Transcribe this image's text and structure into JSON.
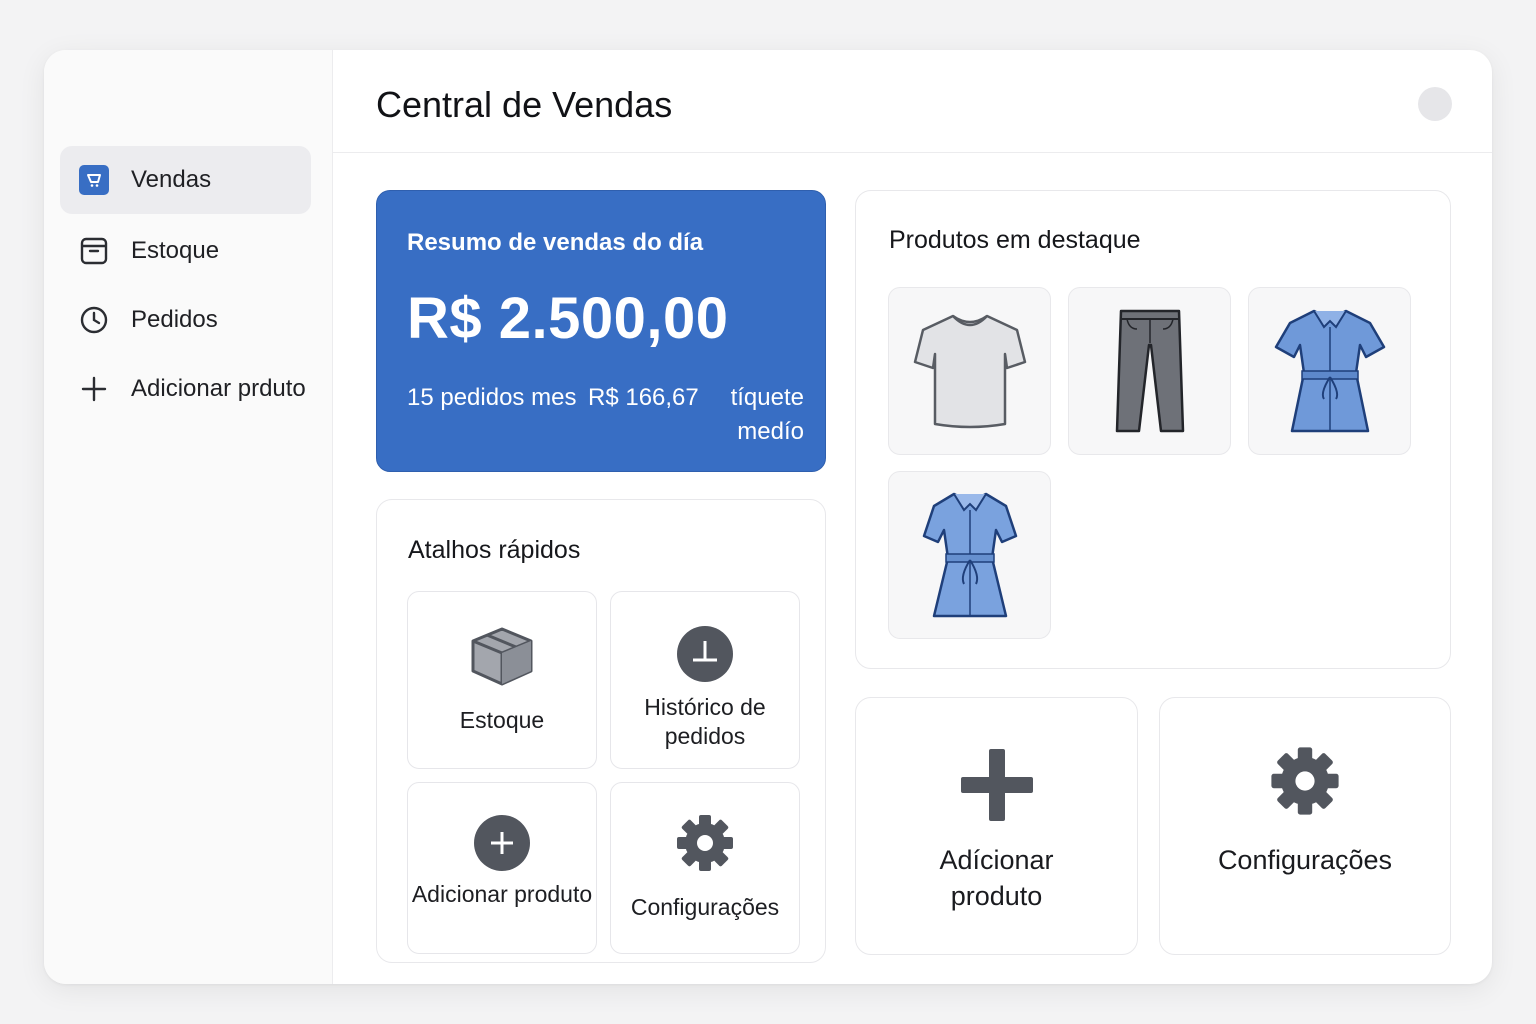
{
  "app": {
    "title": "Central de Vendas"
  },
  "sidebar": {
    "items": [
      {
        "label": "Vendas",
        "icon": "cart-icon",
        "active": true
      },
      {
        "label": "Estoque",
        "icon": "inventory-icon",
        "active": false
      },
      {
        "label": "Pedidos",
        "icon": "clock-icon",
        "active": false
      },
      {
        "label": "Adicionar prduto",
        "icon": "plus-icon",
        "active": false
      }
    ]
  },
  "summary": {
    "title": "Resumo de vendas do día",
    "total": "R$ 2.500,00",
    "orders": "15 pedidos mes",
    "avg_value": "R$ 166,67",
    "avg_label": "tíquete medío"
  },
  "shortcuts": {
    "title": "Atalhos rápidos",
    "items": [
      {
        "label": "Estoque",
        "icon": "box-icon"
      },
      {
        "label": "Histórico de pedidos",
        "icon": "history-icon"
      },
      {
        "label": "Adicionar produto",
        "icon": "plus-circle-icon"
      },
      {
        "label": "Configurações",
        "icon": "gear-icon"
      }
    ]
  },
  "featured": {
    "title": "Produtos em destaque",
    "products": [
      {
        "icon": "tshirt-icon"
      },
      {
        "icon": "pants-icon"
      },
      {
        "icon": "blue-dress-icon"
      },
      {
        "icon": "blue-dress-icon"
      }
    ]
  },
  "actions": {
    "add_label": "Adícionar produto",
    "settings_label": "Configurações"
  },
  "colors": {
    "accent": "#386ec4",
    "icon_dark": "#52565e",
    "dress_blue": "#6f99d9"
  }
}
